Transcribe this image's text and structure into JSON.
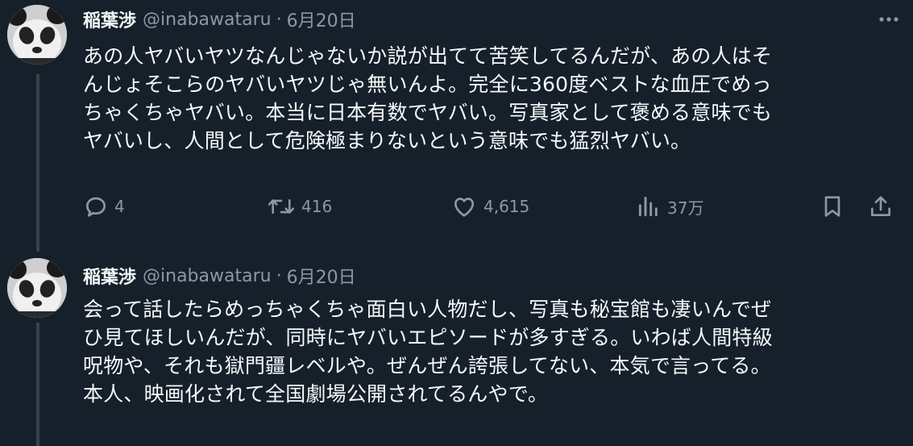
{
  "tweets": [
    {
      "author_name": "稲葉渉",
      "handle": "@inabawataru",
      "separator": "·",
      "date": "6月20日",
      "text_lines": [
        "あの人ヤバいヤツなんじゃないか説が出てて苦笑してるんだが、あの人はそ",
        "んじょそこらのヤバいヤツじゃ無いんよ。完全に360度ベストな血圧でめっ",
        "ちゃくちゃヤバい。本当に日本有数でヤバい。写真家として褒める意味でも",
        "ヤバいし、人間として危険極まりないという意味でも猛烈ヤバい。"
      ],
      "replies": "4",
      "retweets": "416",
      "likes": "4,615",
      "views": "37万"
    },
    {
      "author_name": "稲葉渉",
      "handle": "@inabawataru",
      "separator": "·",
      "date": "6月20日",
      "text_lines": [
        "会って話したらめっちゃくちゃ面白い人物だし、写真も秘宝館も凄いんでぜ",
        "ひ見てほしいんだが、同時にヤバいエピソードが多すぎる。いわば人間特級",
        "呪物や、それも獄門疆レベルや。ぜんぜん誇張してない、本気で言ってる。",
        "本人、映画化されて全国劇場公開されてるんやで。"
      ]
    }
  ],
  "icons": {
    "reply": "reply-icon",
    "retweet": "retweet-icon",
    "like": "heart-icon",
    "views": "views-icon",
    "bookmark": "bookmark-icon",
    "share": "share-icon",
    "more": "more-icon"
  },
  "colors": {
    "background": "#15202b",
    "text": "#f7f9f9",
    "secondary": "#8b98a5",
    "thread_line": "#38444d"
  }
}
